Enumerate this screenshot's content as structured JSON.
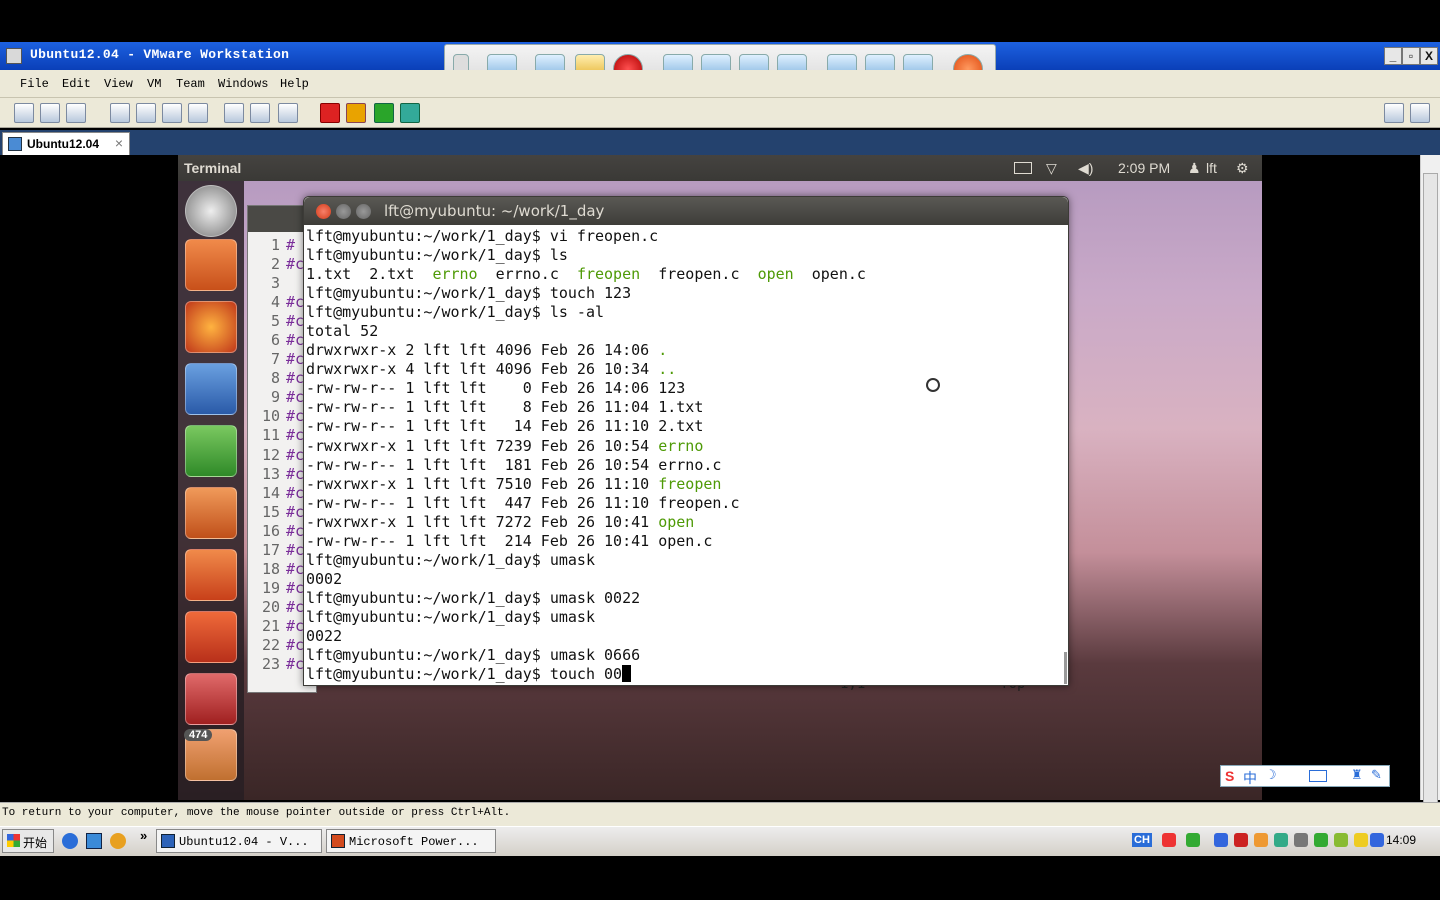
{
  "vmware": {
    "title": "Ubuntu12.04 - VMware Workstation",
    "menus": [
      "File",
      "Edit",
      "View",
      "VM",
      "Team",
      "Windows",
      "Help"
    ],
    "tab_label": "Ubuntu12.04",
    "tab_close": "×",
    "window_buttons": {
      "minimize": "_",
      "maximize": "▫",
      "close": "X"
    },
    "status_text": "To return to your computer, move the mouse pointer outside or press Ctrl+Alt."
  },
  "ubuntu": {
    "panel_title": "Terminal",
    "time": "2:09 PM",
    "user": "lft",
    "badge_count": "474"
  },
  "gedit": {
    "line_numbers": [
      "1",
      "2",
      "3",
      "4",
      "5",
      "6",
      "7",
      "8",
      "9",
      "10",
      "11",
      "12",
      "13",
      "14",
      "15",
      "16",
      "17",
      "18",
      "19",
      "20",
      "21",
      "22",
      "23"
    ],
    "line_prefixes": [
      "#",
      "#c",
      "",
      "#c",
      "#c",
      "#c",
      "#c",
      "#c",
      "#c",
      "#c",
      "#c",
      "#c",
      "#c",
      "#c",
      "#c",
      "#c",
      "#c",
      "#c",
      "#c",
      "#c",
      "#c",
      "#c",
      "#c"
    ],
    "status_pos": "1,1",
    "status_where": "Top"
  },
  "terminal": {
    "title": "lft@myubuntu: ~/work/1_day",
    "lines": [
      [
        {
          "t": "lft@myubuntu:~/work/1_day$ vi freopen.c"
        }
      ],
      [
        {
          "t": "lft@myubuntu:~/work/1_day$ ls"
        }
      ],
      [
        {
          "t": "1.txt  2.txt  "
        },
        {
          "t": "errno",
          "g": true
        },
        {
          "t": "  errno.c  "
        },
        {
          "t": "freopen",
          "g": true
        },
        {
          "t": "  freopen.c  "
        },
        {
          "t": "open",
          "g": true
        },
        {
          "t": "  open.c"
        }
      ],
      [
        {
          "t": "lft@myubuntu:~/work/1_day$ touch 123"
        }
      ],
      [
        {
          "t": "lft@myubuntu:~/work/1_day$ ls -al"
        }
      ],
      [
        {
          "t": "total 52"
        }
      ],
      [
        {
          "t": "drwxrwxr-x 2 lft lft 4096 Feb 26 14:06 "
        },
        {
          "t": ".",
          "g": true
        }
      ],
      [
        {
          "t": "drwxrwxr-x 4 lft lft 4096 Feb 26 10:34 "
        },
        {
          "t": "..",
          "g": true
        }
      ],
      [
        {
          "t": "-rw-rw-r-- 1 lft lft    0 Feb 26 14:06 123"
        }
      ],
      [
        {
          "t": "-rw-rw-r-- 1 lft lft    8 Feb 26 11:04 1.txt"
        }
      ],
      [
        {
          "t": "-rw-rw-r-- 1 lft lft   14 Feb 26 11:10 2.txt"
        }
      ],
      [
        {
          "t": "-rwxrwxr-x 1 lft lft 7239 Feb 26 10:54 "
        },
        {
          "t": "errno",
          "g": true
        }
      ],
      [
        {
          "t": "-rw-rw-r-- 1 lft lft  181 Feb 26 10:54 errno.c"
        }
      ],
      [
        {
          "t": "-rwxrwxr-x 1 lft lft 7510 Feb 26 11:10 "
        },
        {
          "t": "freopen",
          "g": true
        }
      ],
      [
        {
          "t": "-rw-rw-r-- 1 lft lft  447 Feb 26 11:10 freopen.c"
        }
      ],
      [
        {
          "t": "-rwxrwxr-x 1 lft lft 7272 Feb 26 10:41 "
        },
        {
          "t": "open",
          "g": true
        }
      ],
      [
        {
          "t": "-rw-rw-r-- 1 lft lft  214 Feb 26 10:41 open.c"
        }
      ],
      [
        {
          "t": "lft@myubuntu:~/work/1_day$ umask"
        }
      ],
      [
        {
          "t": "0002"
        }
      ],
      [
        {
          "t": "lft@myubuntu:~/work/1_day$ umask 0022"
        }
      ],
      [
        {
          "t": "lft@myubuntu:~/work/1_day$ umask"
        }
      ],
      [
        {
          "t": "0022"
        }
      ],
      [
        {
          "t": "lft@myubuntu:~/work/1_day$ umask 0666"
        }
      ],
      [
        {
          "t": "lft@myubuntu:~/work/1_day$ touch 00"
        }
      ]
    ]
  },
  "taskbar": {
    "start_label": "开始",
    "more": "»",
    "buttons": [
      "Ubuntu12.04 - V...",
      "Microsoft Power..."
    ],
    "ime": "CH",
    "clock": "14:09"
  },
  "ime_bar": {
    "label": "中"
  },
  "colors": {
    "accent": "#0a3fb8",
    "term_green": "#4e9a06",
    "ubuntu_orange": "#dd4814"
  }
}
